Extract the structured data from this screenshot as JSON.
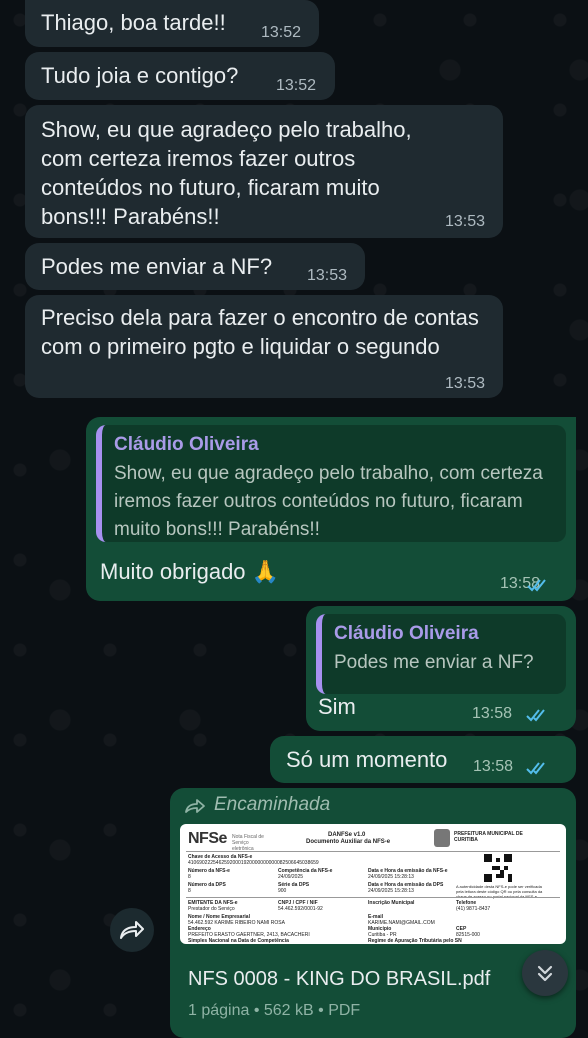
{
  "incoming": [
    {
      "text": "Thiago, boa tarde!!",
      "time": "13:52"
    },
    {
      "text": "Tudo joia e contigo?",
      "time": "13:52"
    },
    {
      "text": "Show, eu que agradeço pelo trabalho, com certeza iremos fazer outros conteúdos no futuro, ficaram muito bons!!! Parabéns!!",
      "time": "13:53"
    },
    {
      "text": "Podes me enviar a NF?",
      "time": "13:53"
    },
    {
      "text": "Preciso dela para fazer o encontro de contas com o primeiro pgto e liquidar o segundo",
      "time": "13:53"
    }
  ],
  "outgoing": [
    {
      "quote_author": "Cláudio Oliveira",
      "quote_text": "Show, eu que agradeço pelo trabalho, com certeza iremos fazer outros conteúdos no futuro, ficaram muito bons!!! Parabéns!!",
      "text": "Muito obrigado 🙏",
      "time": "13:58"
    },
    {
      "quote_author": "Cláudio Oliveira",
      "quote_text": "Podes me enviar a NF?",
      "text": "Sim",
      "time": "13:58"
    },
    {
      "text": "Só um momento",
      "time": "13:58"
    }
  ],
  "document": {
    "forwarded_label": "Encaminhada",
    "filename": "NFS 0008 - KING DO BRASIL.pdf",
    "meta": "1 página • 562 kB • PDF",
    "preview": {
      "logo": "NFSe",
      "logo_sub": "Nota Fiscal de Serviço eletrônica",
      "doc_title": "DANFSe v1.0",
      "doc_subtitle": "Documento Auxiliar da NFS-e",
      "issuer": "PREFEITURA MUNICIPAL DE CURITIBA",
      "key_label": "Chave de Acesso da NFS-e",
      "key_value": "41069022254625920001920000000000082506645038659",
      "number_label": "Número da NFS-e",
      "number_value": "8",
      "competence_label": "Competência da NFS-e",
      "competence_value": "24/09/2025",
      "issue_label": "Data e Hora da emissão da NFS-e",
      "issue_value": "24/09/2025 15:28:13",
      "dps_label": "Número da DPS",
      "dps_value": "8",
      "series_label": "Série da DPS",
      "series_value": "900",
      "dps_date_label": "Data e Hora da emissão da DPS",
      "dps_date_value": "24/09/2025 15:28:13",
      "emitter_label": "EMITENTE DA NFS-e",
      "emitter_sub": "Prestador do Serviço",
      "cnpj_label": "CNPJ / CPF / NIF",
      "cnpj_value": "54.462.592/0001-92",
      "im_label": "Inscrição Municipal",
      "phone_label": "Telefone",
      "phone_value": "(41) 9871-8437",
      "name_label": "Nome / Nome Empresarial",
      "name_value": "54.462.592 KARIME RIBEIRO NAMI ROSA",
      "email_label": "E-mail",
      "email_value": "KARIME.NAMI@GMAIL.COM",
      "address_label": "Endereço",
      "address_value": "PREFEITO ERASTO GAERTNER, 2413, BACACHERI",
      "city_label": "Município",
      "city_value": "Curitiba - PR",
      "cep_label": "CEP",
      "cep_value": "82515-000",
      "simples_label": "Simples Nacional na Data de Competência",
      "regime_label": "Regime de Apuração Tributária pelo SN",
      "qr_note": "A autenticidade desta NFS-e pode ser verificada pela leitura deste código QR ou pela consulta da chave de acesso no portal nacional da NFS-e"
    }
  },
  "colors": {
    "incoming_bubble": "#1f2a30",
    "outgoing_bubble": "#134d37",
    "quote_accent": "#a791f0",
    "read_ticks": "#53bdeb"
  }
}
